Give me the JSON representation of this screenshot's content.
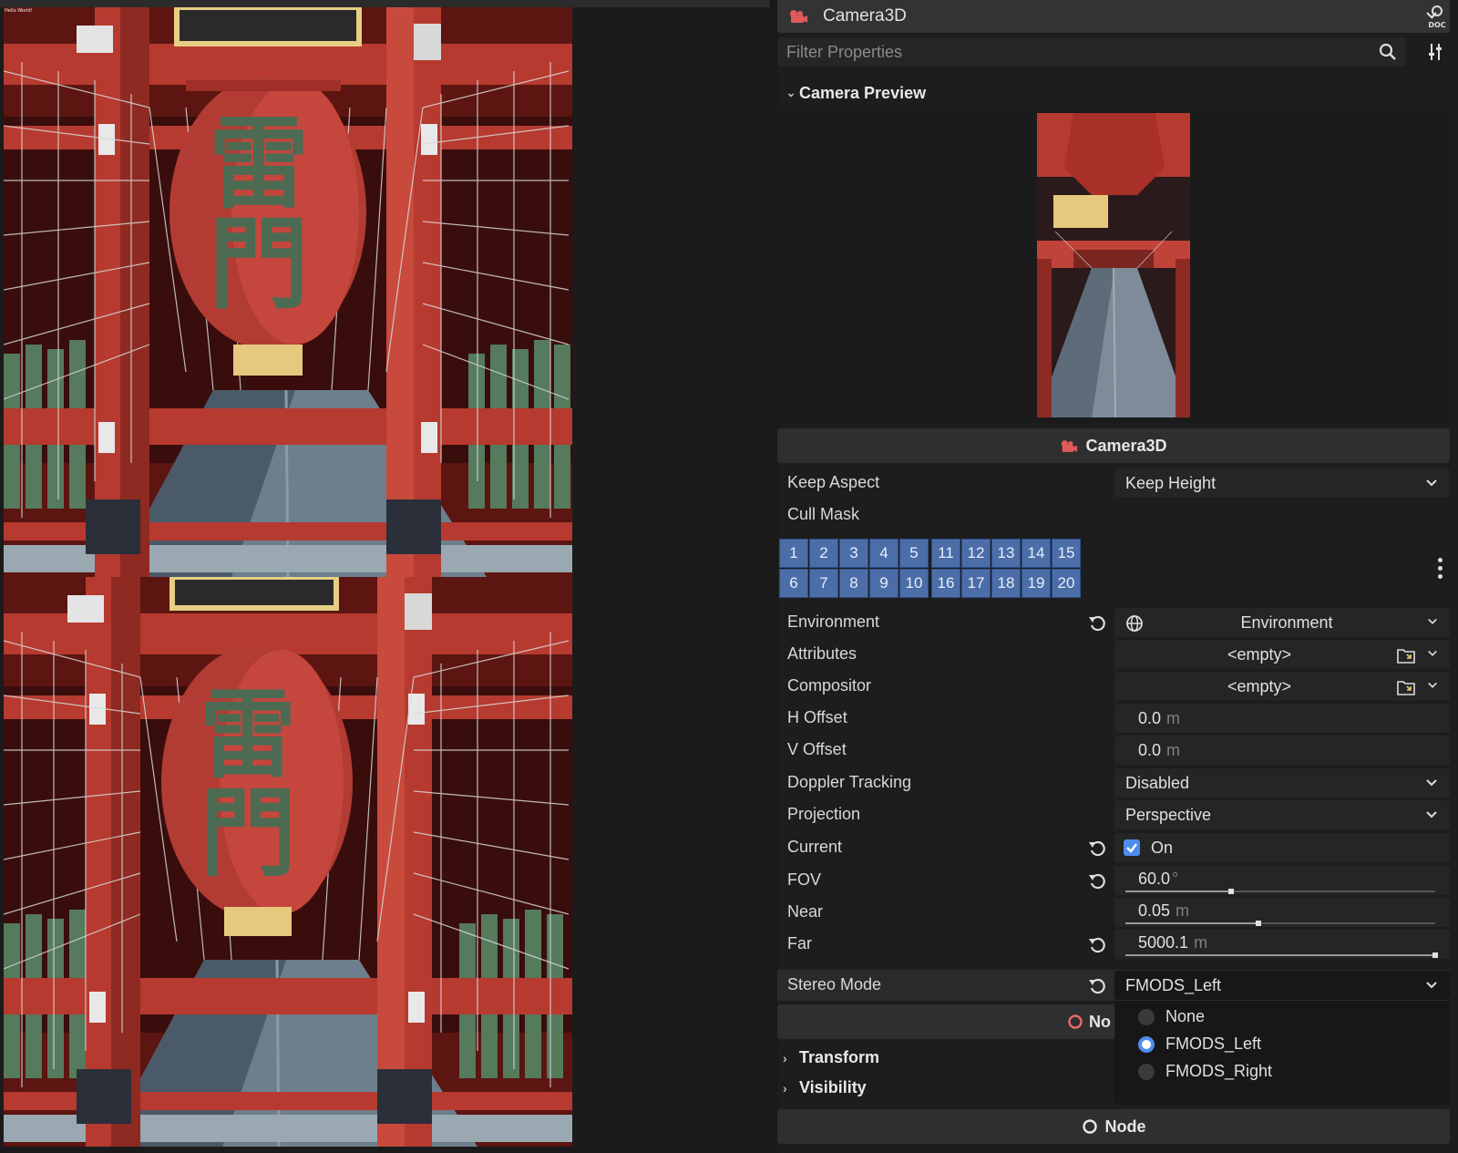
{
  "viewport": {
    "overlay_text": "Hello World!"
  },
  "inspector": {
    "node_selector": {
      "label": "Camera3D",
      "icon": "camera-icon"
    },
    "doc_button": {
      "icon": "doc-search-icon"
    },
    "filter": {
      "placeholder": "Filter Properties",
      "icon": "search-icon",
      "options_icon": "filter-options-icon"
    },
    "camera_preview": {
      "label": "Camera Preview"
    },
    "class_header": {
      "label": "Camera3D",
      "icon": "camera-icon"
    },
    "properties": {
      "keep_aspect": {
        "label": "Keep Aspect",
        "value": "Keep Height"
      },
      "cull_mask": {
        "label": "Cull Mask",
        "layers": [
          "1",
          "2",
          "3",
          "4",
          "5",
          "6",
          "7",
          "8",
          "9",
          "10",
          "11",
          "12",
          "13",
          "14",
          "15",
          "16",
          "17",
          "18",
          "19",
          "20"
        ]
      },
      "environment": {
        "label": "Environment",
        "value": "Environment"
      },
      "attributes": {
        "label": "Attributes",
        "value": "<empty>"
      },
      "compositor": {
        "label": "Compositor",
        "value": "<empty>"
      },
      "h_offset": {
        "label": "H Offset",
        "value": "0.0",
        "unit": "m"
      },
      "v_offset": {
        "label": "V Offset",
        "value": "0.0",
        "unit": "m"
      },
      "doppler_tracking": {
        "label": "Doppler Tracking",
        "value": "Disabled"
      },
      "projection": {
        "label": "Projection",
        "value": "Perspective"
      },
      "current": {
        "label": "Current",
        "value": "On",
        "checked": true
      },
      "fov": {
        "label": "FOV",
        "value": "60.0",
        "unit": "°",
        "slider_fraction": 0.34
      },
      "near": {
        "label": "Near",
        "value": "0.05",
        "unit": "m",
        "slider_fraction": 0.43
      },
      "far": {
        "label": "Far",
        "value": "5000.1",
        "unit": "m",
        "slider_fraction": 1.0
      },
      "stereo_mode": {
        "label": "Stereo Mode",
        "value": "FMODS_Left"
      }
    },
    "stereo_options": [
      {
        "label": "None",
        "selected": false
      },
      {
        "label": "FMODS_Left",
        "selected": true
      },
      {
        "label": "FMODS_Right",
        "selected": false
      }
    ],
    "node3d_header": {
      "label": "No"
    },
    "sections": {
      "transform": "Transform",
      "visibility": "Visibility"
    },
    "node_header": {
      "label": "Node"
    }
  },
  "colors": {
    "accent_blue": "#4e8cf0",
    "cull_mask_blue": "#4b6da8",
    "camera_icon_red": "#e05a5a",
    "node_icon_red": "#e86a6a"
  }
}
